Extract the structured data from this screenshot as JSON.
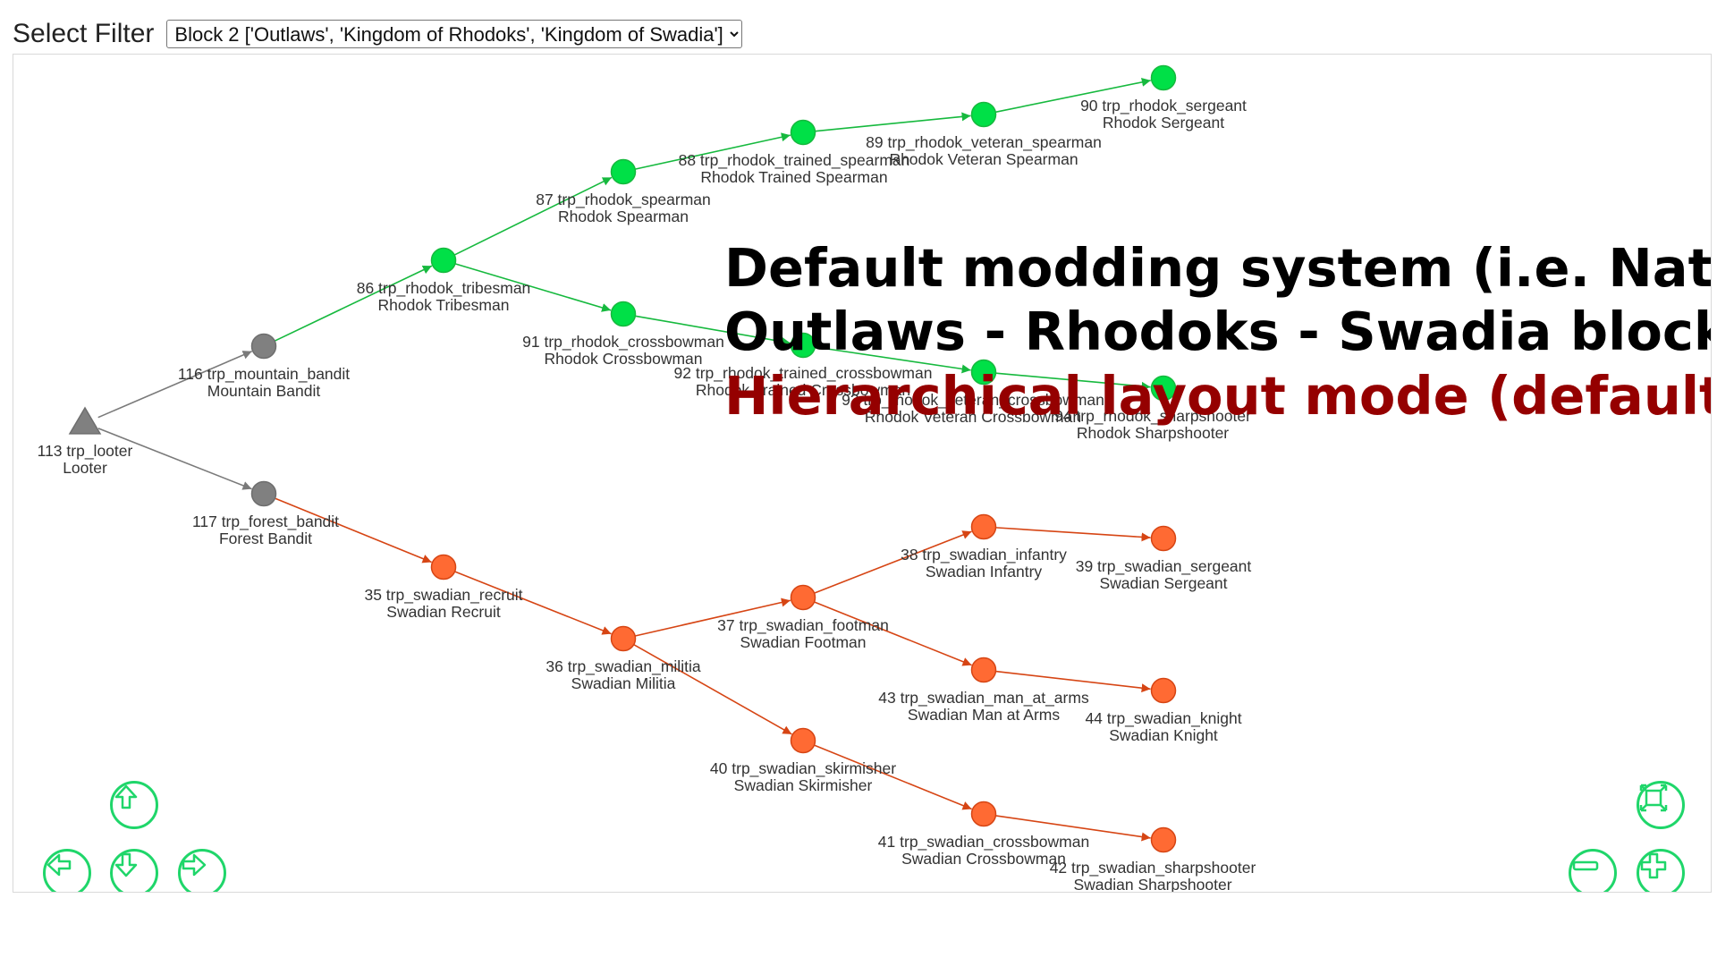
{
  "filter": {
    "label": "Select Filter",
    "selected": "Block 2 ['Outlaws', 'Kingdom of Rhodoks', 'Kingdom of Swadia']"
  },
  "overlay": {
    "line1": "Default modding system (i.e. Native)",
    "line2": "Outlaws - Rhodoks - Swadia block",
    "line3": "Hierarchical layout mode (default)"
  },
  "colors": {
    "outlaw": "#808080",
    "rhodok": "#00e047",
    "swadia": "#ff6a33",
    "rhodok_edge": "#16b93e",
    "swadia_edge": "#d64514",
    "outlaw_edge": "#7a7a7a",
    "nav_button": "#1fd66a"
  },
  "nav_icons": {
    "up": "arrow-up-icon",
    "down": "arrow-down-icon",
    "left": "arrow-left-icon",
    "right": "arrow-right-icon",
    "fit": "fit-screen-icon",
    "zoom_out": "zoom-out-icon",
    "zoom_in": "zoom-in-icon"
  },
  "nodes": [
    {
      "id": "113",
      "name": "trp_looter",
      "title": "Looter",
      "group": "outlaw",
      "shape": "triangle"
    },
    {
      "id": "116",
      "name": "trp_mountain_bandit",
      "title": "Mountain Bandit",
      "group": "outlaw",
      "shape": "dot"
    },
    {
      "id": "117",
      "name": "trp_forest_bandit",
      "title": "Forest Bandit",
      "group": "outlaw",
      "shape": "dot"
    },
    {
      "id": "86",
      "name": "trp_rhodok_tribesman",
      "title": "Rhodok Tribesman",
      "group": "rhodok",
      "shape": "dot"
    },
    {
      "id": "87",
      "name": "trp_rhodok_spearman",
      "title": "Rhodok Spearman",
      "group": "rhodok",
      "shape": "dot"
    },
    {
      "id": "88",
      "name": "trp_rhodok_trained_spearman",
      "title": "Rhodok Trained Spearman",
      "group": "rhodok",
      "shape": "dot"
    },
    {
      "id": "89",
      "name": "trp_rhodok_veteran_spearman",
      "title": "Rhodok Veteran Spearman",
      "group": "rhodok",
      "shape": "dot"
    },
    {
      "id": "90",
      "name": "trp_rhodok_sergeant",
      "title": "Rhodok Sergeant",
      "group": "rhodok",
      "shape": "dot"
    },
    {
      "id": "91",
      "name": "trp_rhodok_crossbowman",
      "title": "Rhodok Crossbowman",
      "group": "rhodok",
      "shape": "dot"
    },
    {
      "id": "92",
      "name": "trp_rhodok_trained_crossbowman",
      "title": "Rhodok Trained Crossbowman",
      "group": "rhodok",
      "shape": "dot"
    },
    {
      "id": "93",
      "name": "trp_rhodok_veteran_crossbowman",
      "title": "Rhodok Veteran Crossbowman",
      "group": "rhodok",
      "shape": "dot"
    },
    {
      "id": "94",
      "name": "trp_rhodok_sharpshooter",
      "title": "Rhodok Sharpshooter",
      "group": "rhodok",
      "shape": "dot"
    },
    {
      "id": "35",
      "name": "trp_swadian_recruit",
      "title": "Swadian Recruit",
      "group": "swadia",
      "shape": "dot"
    },
    {
      "id": "36",
      "name": "trp_swadian_militia",
      "title": "Swadian Militia",
      "group": "swadia",
      "shape": "dot"
    },
    {
      "id": "37",
      "name": "trp_swadian_footman",
      "title": "Swadian Footman",
      "group": "swadia",
      "shape": "dot"
    },
    {
      "id": "38",
      "name": "trp_swadian_infantry",
      "title": "Swadian Infantry",
      "group": "swadia",
      "shape": "dot"
    },
    {
      "id": "39",
      "name": "trp_swadian_sergeant",
      "title": "Swadian Sergeant",
      "group": "swadia",
      "shape": "dot"
    },
    {
      "id": "43",
      "name": "trp_swadian_man_at_arms",
      "title": "Swadian Man at Arms",
      "group": "swadia",
      "shape": "dot"
    },
    {
      "id": "44",
      "name": "trp_swadian_knight",
      "title": "Swadian Knight",
      "group": "swadia",
      "shape": "dot"
    },
    {
      "id": "40",
      "name": "trp_swadian_skirmisher",
      "title": "Swadian Skirmisher",
      "group": "swadia",
      "shape": "dot"
    },
    {
      "id": "41",
      "name": "trp_swadian_crossbowman",
      "title": "Swadian Crossbowman",
      "group": "swadia",
      "shape": "dot"
    },
    {
      "id": "42",
      "name": "trp_swadian_sharpshooter",
      "title": "Swadian Sharpshooter",
      "group": "swadia",
      "shape": "dot"
    }
  ],
  "edges": [
    {
      "from": "113",
      "to": "116"
    },
    {
      "from": "113",
      "to": "117"
    },
    {
      "from": "116",
      "to": "86"
    },
    {
      "from": "117",
      "to": "35"
    },
    {
      "from": "86",
      "to": "87"
    },
    {
      "from": "86",
      "to": "91"
    },
    {
      "from": "87",
      "to": "88"
    },
    {
      "from": "88",
      "to": "89"
    },
    {
      "from": "89",
      "to": "90"
    },
    {
      "from": "91",
      "to": "92"
    },
    {
      "from": "92",
      "to": "93"
    },
    {
      "from": "93",
      "to": "94"
    },
    {
      "from": "35",
      "to": "36"
    },
    {
      "from": "36",
      "to": "37"
    },
    {
      "from": "36",
      "to": "40"
    },
    {
      "from": "37",
      "to": "38"
    },
    {
      "from": "37",
      "to": "43"
    },
    {
      "from": "38",
      "to": "39"
    },
    {
      "from": "43",
      "to": "44"
    },
    {
      "from": "40",
      "to": "41"
    },
    {
      "from": "41",
      "to": "42"
    }
  ]
}
